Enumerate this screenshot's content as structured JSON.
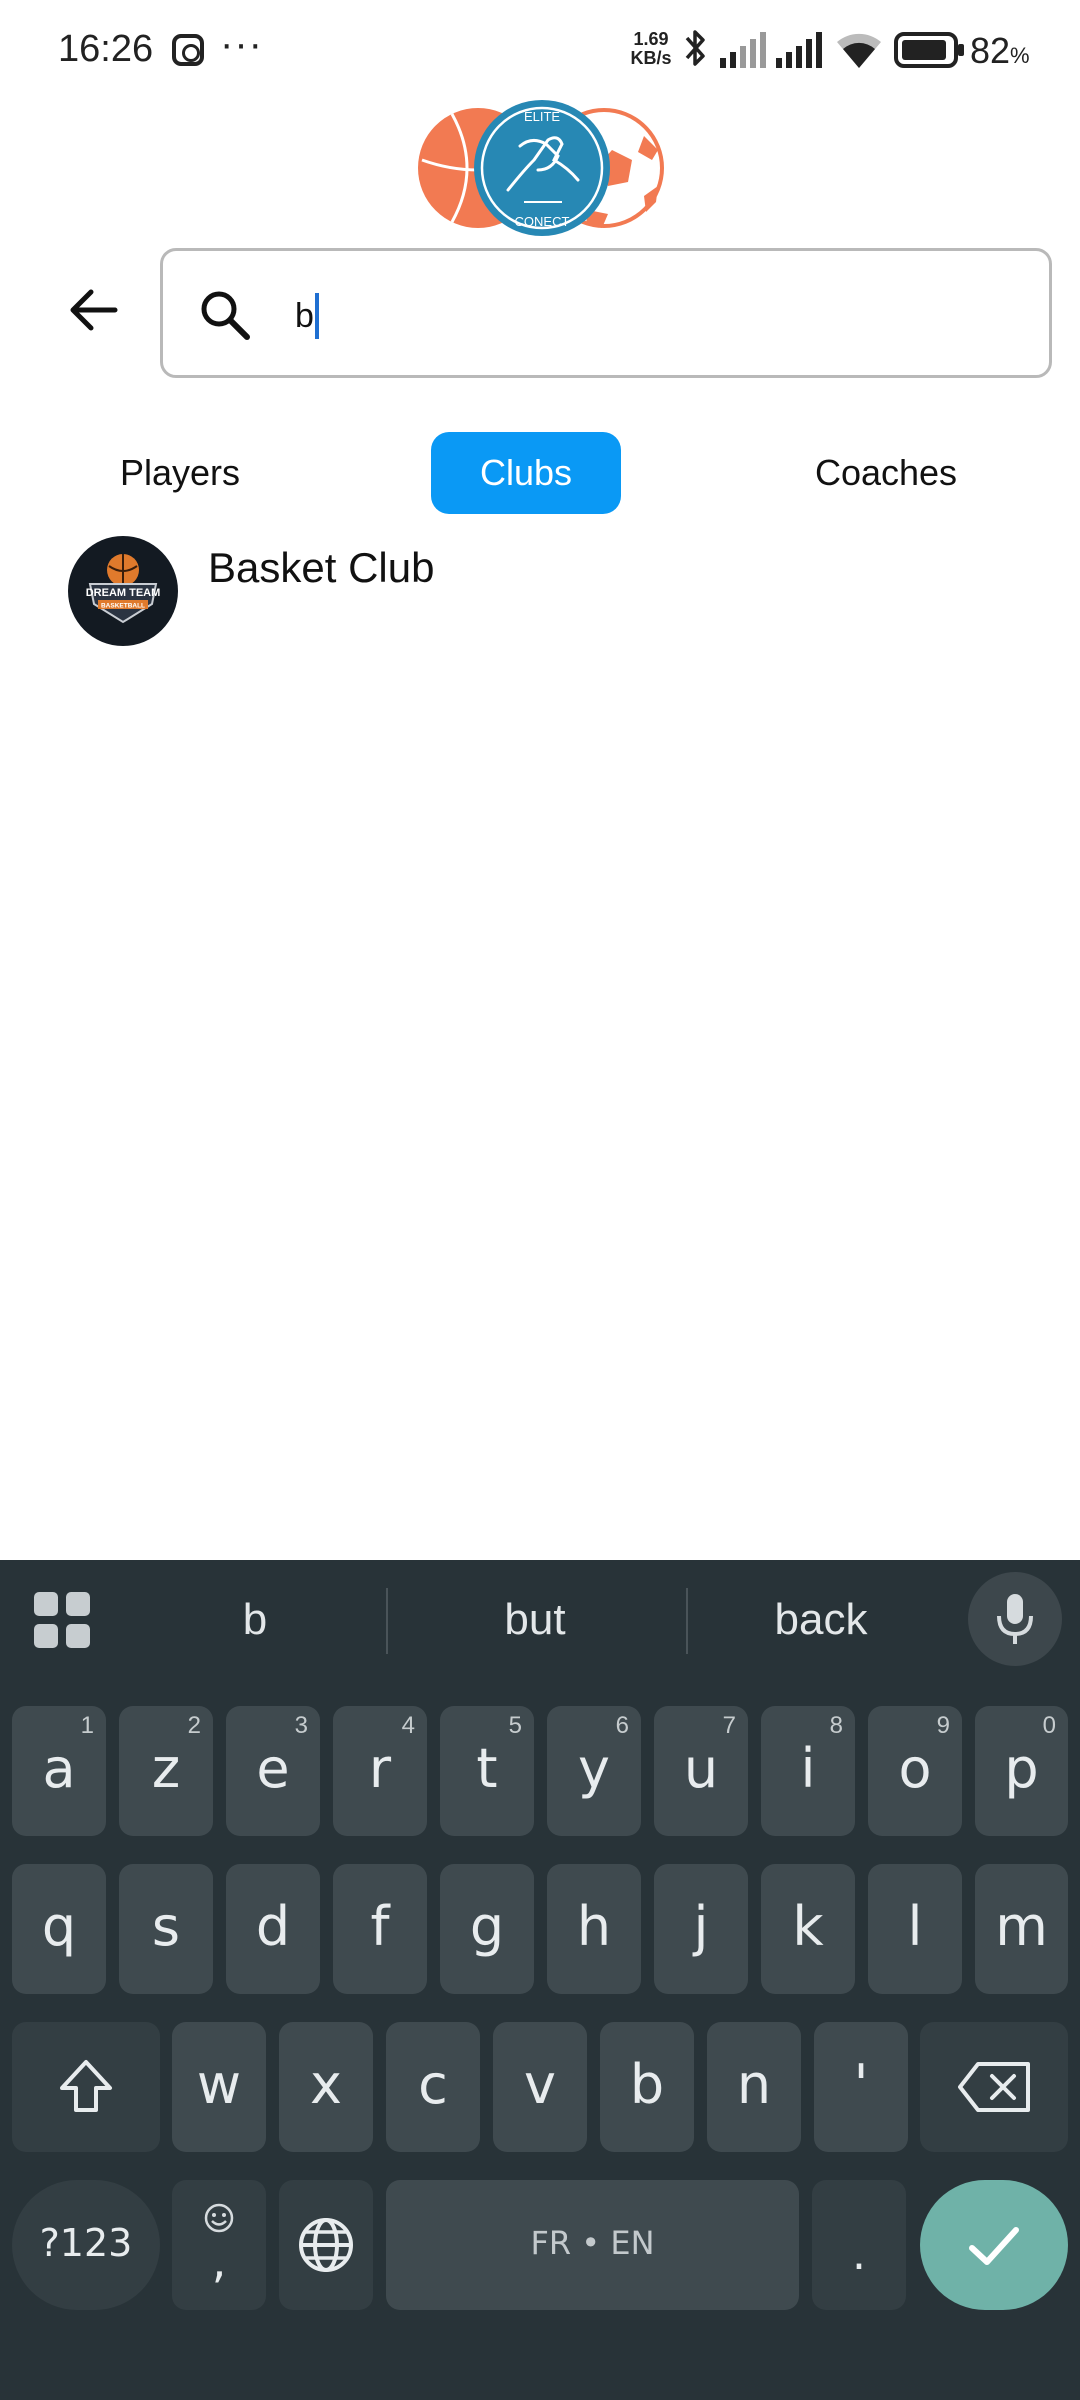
{
  "status_bar": {
    "time": "16:26",
    "more": "···",
    "net_speed_value": "1.69",
    "net_speed_unit": "KB/s",
    "battery_percent": "82",
    "battery_unit": "%",
    "icons": [
      "instagram-icon",
      "bluetooth-icon",
      "signal-icon",
      "wifi-icon",
      "battery-icon"
    ]
  },
  "logo": {
    "top_text": "ELITE",
    "bottom_text": "CONECT"
  },
  "search": {
    "value": "b",
    "placeholder": ""
  },
  "tabs": {
    "items": [
      {
        "label": "Players"
      },
      {
        "label": "Clubs"
      },
      {
        "label": "Coaches"
      }
    ],
    "active": "Clubs",
    "active_color": "#0a99f5"
  },
  "results": [
    {
      "name": "Basket Club",
      "logo_text_1": "DREAM TEAM",
      "logo_text_2": "BASKETBALL"
    }
  ],
  "keyboard": {
    "suggestions": [
      "b",
      "but",
      "back"
    ],
    "row1": [
      {
        "k": "a",
        "h": "1"
      },
      {
        "k": "z",
        "h": "2"
      },
      {
        "k": "e",
        "h": "3"
      },
      {
        "k": "r",
        "h": "4"
      },
      {
        "k": "t",
        "h": "5"
      },
      {
        "k": "y",
        "h": "6"
      },
      {
        "k": "u",
        "h": "7"
      },
      {
        "k": "i",
        "h": "8"
      },
      {
        "k": "o",
        "h": "9"
      },
      {
        "k": "p",
        "h": "0"
      }
    ],
    "row2": [
      "q",
      "s",
      "d",
      "f",
      "g",
      "h",
      "j",
      "k",
      "l",
      "m"
    ],
    "row3": [
      "w",
      "x",
      "c",
      "v",
      "b",
      "n",
      "'"
    ],
    "symbols_label": "?123",
    "comma_label": ",",
    "space_label": "FR • EN",
    "period_label": ".",
    "accent_color": "#6fb2a8",
    "background_color": "#283338"
  }
}
